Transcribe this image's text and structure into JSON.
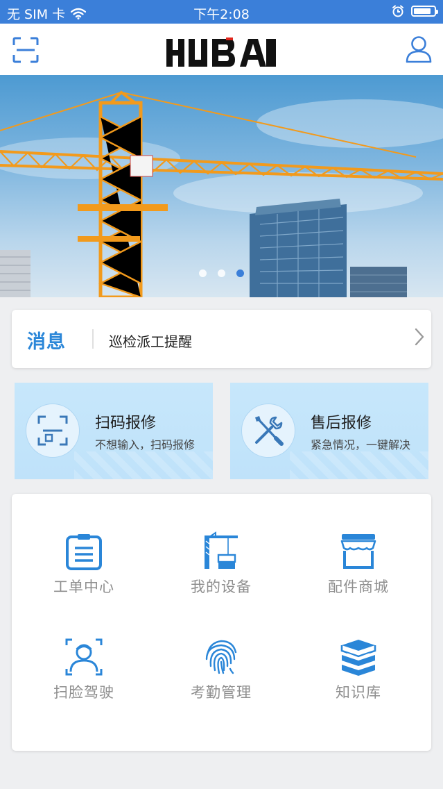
{
  "status_bar": {
    "carrier": "无 SIM 卡",
    "time": "下午2:08"
  },
  "nav": {
    "logo_text": "HUBA",
    "scan_icon": "scan-frame-icon",
    "profile_icon": "user-icon"
  },
  "banner": {
    "slide_count": 3,
    "active_index": 2
  },
  "message": {
    "tag": "消息",
    "text": "巡检派工提醒"
  },
  "quick_actions": [
    {
      "title": "扫码报修",
      "subtitle": "不想输入，扫码报修",
      "icon": "scan-icon"
    },
    {
      "title": "售后报修",
      "subtitle": "紧急情况，一键解决",
      "icon": "wrench-screwdriver-icon"
    }
  ],
  "grid": [
    {
      "label": "工单中心",
      "icon": "clipboard-icon"
    },
    {
      "label": "我的设备",
      "icon": "tower-crane-icon"
    },
    {
      "label": "配件商城",
      "icon": "store-icon"
    },
    {
      "label": "扫脸驾驶",
      "icon": "face-scan-icon"
    },
    {
      "label": "考勤管理",
      "icon": "fingerprint-icon"
    },
    {
      "label": "知识库",
      "icon": "books-icon"
    }
  ],
  "colors": {
    "primary": "#3b7fd9",
    "accent_blue": "#2a86d8",
    "quick_card_bg": "#c7e7fb",
    "label_gray": "#8f8f8f"
  }
}
